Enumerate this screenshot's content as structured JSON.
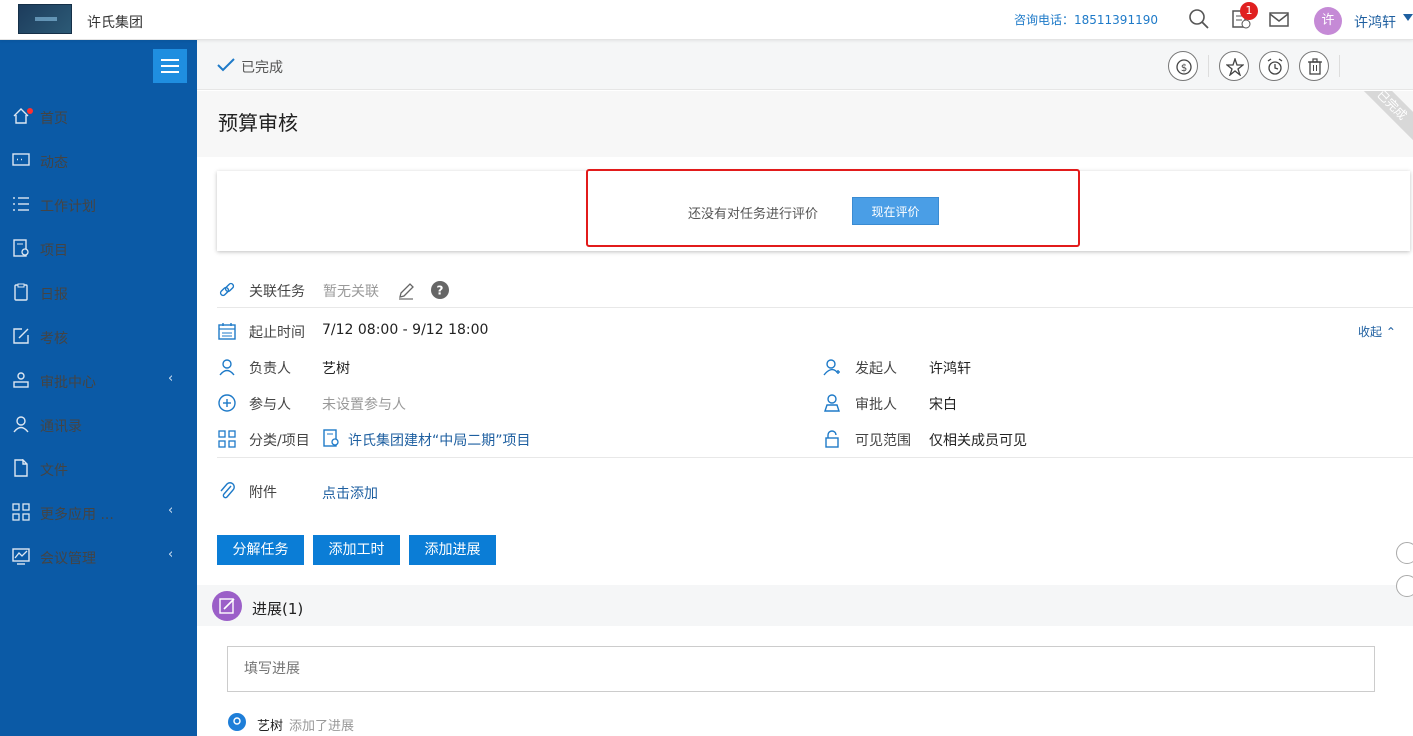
{
  "header": {
    "company": "许氏集团",
    "hotline": "咨询电话：18511391190",
    "notification_count": "1",
    "avatar_text": "许",
    "username": "许鸿轩"
  },
  "sidebar": {
    "items": [
      {
        "label": "首页",
        "icon": "home-icon"
      },
      {
        "label": "动态",
        "icon": "chat-icon"
      },
      {
        "label": "工作计划",
        "icon": "list-icon"
      },
      {
        "label": "项目",
        "icon": "project-icon"
      },
      {
        "label": "日报",
        "icon": "daily-report-icon"
      },
      {
        "label": "考核",
        "icon": "assessment-icon"
      },
      {
        "label": "审批中心",
        "icon": "approval-icon",
        "arrow": "‹"
      },
      {
        "label": "通讯录",
        "icon": "contacts-icon"
      },
      {
        "label": "文件",
        "icon": "file-icon"
      },
      {
        "label": "更多应用 ...",
        "icon": "apps-icon",
        "arrow": "‹"
      },
      {
        "label": "会议管理",
        "icon": "meeting-icon",
        "arrow": "‹"
      }
    ]
  },
  "status": {
    "text": "已完成"
  },
  "task": {
    "title": "预算审核",
    "ribbon": "已完成"
  },
  "evaluation": {
    "text": "还没有对任务进行评价",
    "button": "现在评价"
  },
  "details": {
    "related_label": "关联任务",
    "related_value": "暂无关联",
    "time_label": "起止时间",
    "time_value": "7/12 08:00 - 9/12 18:00",
    "collapse": "收起",
    "owner_label": "负责人",
    "owner_value": "艺树",
    "initiator_label": "发起人",
    "initiator_value": "许鸿轩",
    "participants_label": "参与人",
    "participants_value": "未设置参与人",
    "approver_label": "审批人",
    "approver_value": "宋白",
    "category_label": "分类/项目",
    "category_value": "许氏集团建材“中局二期”项目",
    "visibility_label": "可见范围",
    "visibility_value": "仅相关成员可见",
    "attachment_label": "附件",
    "attachment_value": "点击添加"
  },
  "actions": {
    "split": "分解任务",
    "add_hours": "添加工时",
    "add_progress": "添加进展"
  },
  "progress": {
    "title": "进展(1)",
    "placeholder": "填写进展",
    "entry_user": "艺树",
    "entry_action": "添加了进展"
  }
}
